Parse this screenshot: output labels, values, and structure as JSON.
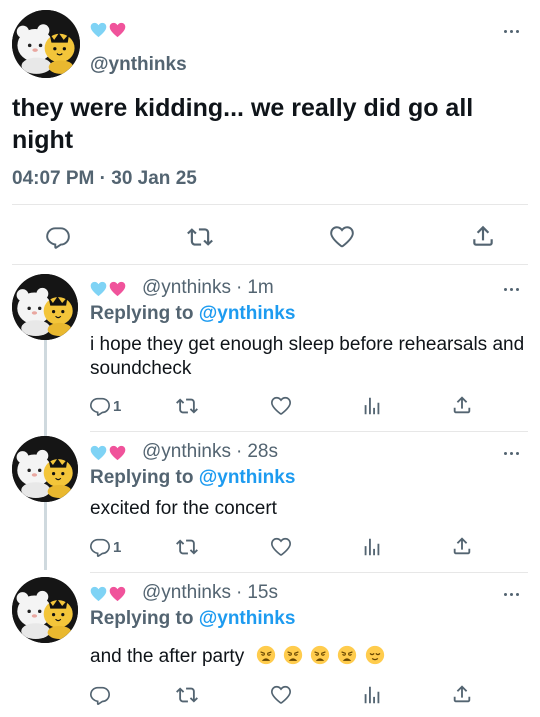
{
  "main_tweet": {
    "avatar_icon": "plush-toys-avatar",
    "handle": "@ynthinks",
    "text": "they were kidding... we really did go all night",
    "timestamp": "04:07 PM · 30 Jan 25",
    "actions": [
      "reply-icon",
      "retweet-icon",
      "like-icon",
      "share-icon"
    ]
  },
  "replies": [
    {
      "handle": "@ynthinks",
      "sep": "·",
      "time": "1m",
      "replying_label": "Replying to",
      "replying_to": "@ynthinks",
      "text": "i hope they get enough sleep before rehearsals and soundcheck",
      "reply_count": "1"
    },
    {
      "handle": "@ynthinks",
      "sep": "·",
      "time": "28s",
      "replying_label": "Replying to",
      "replying_to": "@ynthinks",
      "text": "excited for the concert",
      "reply_count": "1"
    },
    {
      "handle": "@ynthinks",
      "sep": "·",
      "time": "15s",
      "replying_label": "Replying to",
      "replying_to": "@ynthinks",
      "text": "and the after party",
      "emojis": [
        "weary-face",
        "weary-face",
        "weary-face",
        "weary-face",
        "relieved-face"
      ],
      "reply_count": ""
    }
  ],
  "colors": {
    "text": "#0f1419",
    "secondary": "#536471",
    "link": "#1d9bf0",
    "blue_heart": "#7fd3f5",
    "pink_heart": "#f0539b"
  }
}
